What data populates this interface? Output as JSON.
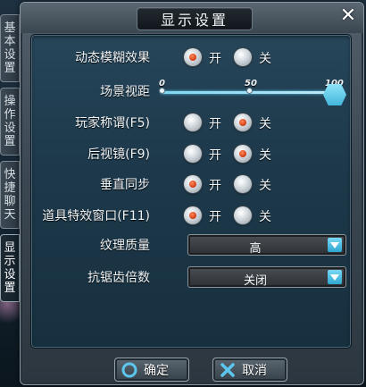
{
  "window": {
    "title": "显示设置",
    "close_glyph": "✕"
  },
  "tabs": [
    {
      "chars": [
        "基",
        "本",
        "设",
        "置"
      ],
      "active": false
    },
    {
      "chars": [
        "操",
        "作",
        "设",
        "置"
      ],
      "active": false
    },
    {
      "chars": [
        "快",
        "捷",
        "聊",
        "天"
      ],
      "active": false
    },
    {
      "chars": [
        "显",
        "示",
        "设",
        "置"
      ],
      "active": true
    }
  ],
  "options": {
    "on_label": "开",
    "off_label": "关"
  },
  "settings": {
    "dynamic_blur": {
      "label": "动态模糊效果",
      "value": "on"
    },
    "view_distance": {
      "label": "场景视距",
      "ticks": [
        "0",
        "50",
        "100"
      ],
      "min": 0,
      "max": 100,
      "value": 100
    },
    "player_titles": {
      "label": "玩家称谓(F5)",
      "value": "off"
    },
    "rear_view": {
      "label": "后视镜(F9)",
      "value": "off"
    },
    "vsync": {
      "label": "垂直同步",
      "value": "on"
    },
    "item_effects_window": {
      "label": "道具特效窗口(F11)",
      "value": "on"
    },
    "texture_quality": {
      "label": "纹理质量",
      "value": "高"
    },
    "antialiasing": {
      "label": "抗锯齿倍数",
      "value": "关闭"
    }
  },
  "buttons": {
    "confirm": "确定",
    "cancel": "取消"
  },
  "colors": {
    "accent_cyan": "#59c8ec",
    "radio_on": "#d9441c",
    "cancel_x": "#5cc6ef"
  }
}
